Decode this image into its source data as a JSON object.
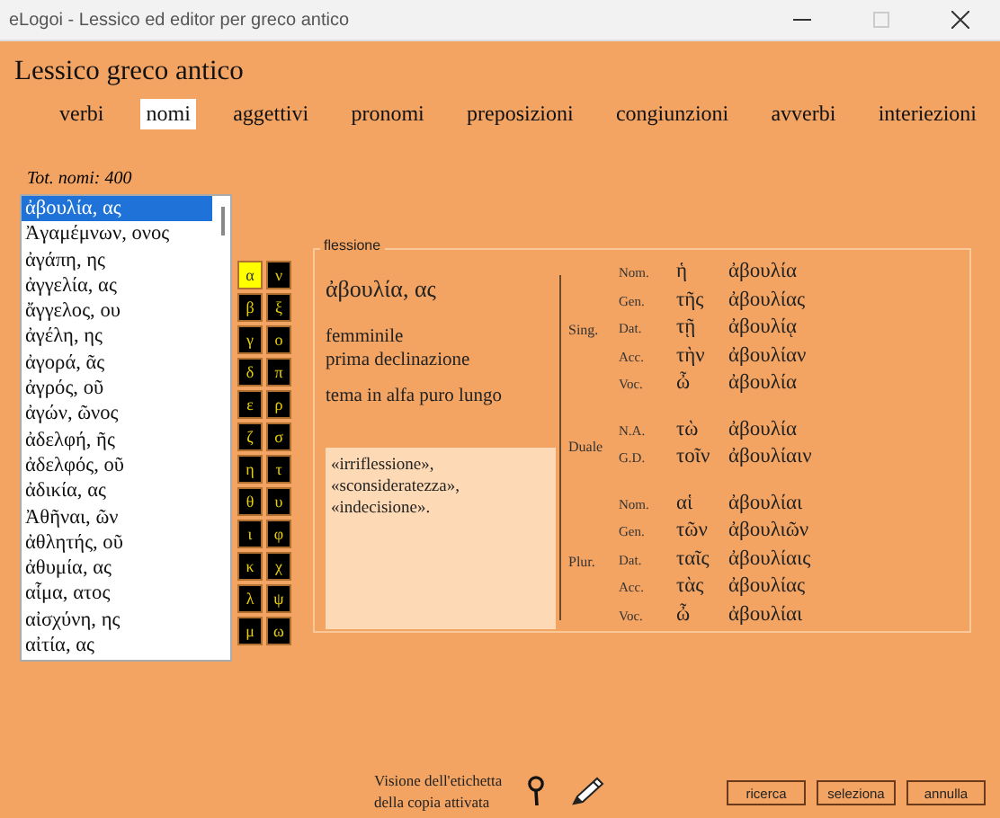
{
  "window": {
    "title": "eLogoi - Lessico ed editor per greco antico"
  },
  "heading": "Lessico greco antico",
  "tabs": [
    {
      "label": "verbi",
      "selected": false
    },
    {
      "label": "nomi",
      "selected": true
    },
    {
      "label": "aggettivi",
      "selected": false
    },
    {
      "label": "pronomi",
      "selected": false
    },
    {
      "label": "preposizioni",
      "selected": false
    },
    {
      "label": "congiunzioni",
      "selected": false
    },
    {
      "label": "avverbi",
      "selected": false
    },
    {
      "label": "interiezioni",
      "selected": false
    }
  ],
  "total": "Tot. nomi: 400",
  "word_list": [
    {
      "text": "ἀβουλία, ας",
      "selected": true
    },
    {
      "text": "Ἀγαμέμνων, ονος",
      "selected": false
    },
    {
      "text": "ἀγάπη, ης",
      "selected": false
    },
    {
      "text": "ἀγγελία, ας",
      "selected": false
    },
    {
      "text": "ἄγγελος, ου",
      "selected": false
    },
    {
      "text": "ἀγέλη, ης",
      "selected": false
    },
    {
      "text": "ἀγορά, ᾶς",
      "selected": false
    },
    {
      "text": "ἀγρός, οῦ",
      "selected": false
    },
    {
      "text": "ἀγών, ῶνος",
      "selected": false
    },
    {
      "text": "ἀδελφή, ῆς",
      "selected": false
    },
    {
      "text": "ἀδελφός, οῦ",
      "selected": false
    },
    {
      "text": "ἀδικία, ας",
      "selected": false
    },
    {
      "text": "Ἀθῆναι, ῶν",
      "selected": false
    },
    {
      "text": "ἀθλητής, οῦ",
      "selected": false
    },
    {
      "text": "ἀθυμία, ας",
      "selected": false
    },
    {
      "text": "αἷμα, ατος",
      "selected": false
    },
    {
      "text": "αἰσχύνη, ης",
      "selected": false
    },
    {
      "text": "αἰτία, ας",
      "selected": false
    }
  ],
  "letters": [
    {
      "letter": "α",
      "selected": true
    },
    {
      "letter": "β",
      "selected": false
    },
    {
      "letter": "γ",
      "selected": false
    },
    {
      "letter": "δ",
      "selected": false
    },
    {
      "letter": "ε",
      "selected": false
    },
    {
      "letter": "ζ",
      "selected": false
    },
    {
      "letter": "η",
      "selected": false
    },
    {
      "letter": "θ",
      "selected": false
    },
    {
      "letter": "ι",
      "selected": false
    },
    {
      "letter": "κ",
      "selected": false
    },
    {
      "letter": "λ",
      "selected": false
    },
    {
      "letter": "μ",
      "selected": false
    },
    {
      "letter": "ν",
      "selected": false
    },
    {
      "letter": "ξ",
      "selected": false
    },
    {
      "letter": "ο",
      "selected": false
    },
    {
      "letter": "π",
      "selected": false
    },
    {
      "letter": "ρ",
      "selected": false
    },
    {
      "letter": "σ",
      "selected": false
    },
    {
      "letter": "τ",
      "selected": false
    },
    {
      "letter": "υ",
      "selected": false
    },
    {
      "letter": "φ",
      "selected": false
    },
    {
      "letter": "χ",
      "selected": false
    },
    {
      "letter": "ψ",
      "selected": false
    },
    {
      "letter": "ω",
      "selected": false
    }
  ],
  "flessione": {
    "legend": "flessione",
    "lemma": "ἀβουλία, ας",
    "gender": "femminile",
    "declension": "prima declinazione",
    "stem": "tema in alfa puro lungo",
    "meaning_lines": [
      "«irriflessione»,",
      "«sconsideratezza»,",
      "«indecisione»."
    ],
    "paradigm": [
      {
        "number": "Sing.",
        "cases": [
          {
            "case": "Nom.",
            "article": "ἡ",
            "form": "ἀβουλία"
          },
          {
            "case": "Gen.",
            "article": "τῆς",
            "form": "ἀβουλίας"
          },
          {
            "case": "Dat.",
            "article": "τῇ",
            "form": "ἀβουλίᾳ"
          },
          {
            "case": "Acc.",
            "article": "τὴν",
            "form": "ἀβουλίαν"
          },
          {
            "case": "Voc.",
            "article": "ὦ",
            "form": "ἀβουλία"
          }
        ]
      },
      {
        "number": "Duale",
        "cases": [
          {
            "case": "N.A.",
            "article": "τὼ",
            "form": "ἀβουλία"
          },
          {
            "case": "G.D.",
            "article": "τοῖν",
            "form": "ἀβουλίαιν"
          }
        ]
      },
      {
        "number": "Plur.",
        "cases": [
          {
            "case": "Nom.",
            "article": "αἱ",
            "form": "ἀβουλίαι"
          },
          {
            "case": "Gen.",
            "article": "τῶν",
            "form": "ἀβουλιῶν"
          },
          {
            "case": "Dat.",
            "article": "ταῖς",
            "form": "ἀβουλίαις"
          },
          {
            "case": "Acc.",
            "article": "τὰς",
            "form": "ἀβουλίας"
          },
          {
            "case": "Voc.",
            "article": "ὦ",
            "form": "ἀβουλίαι"
          }
        ]
      }
    ]
  },
  "footer": {
    "note_lines": [
      "Visione dell'etichetta",
      "della copia attivata"
    ],
    "buttons": [
      "ricerca",
      "seleziona",
      "annulla"
    ]
  }
}
